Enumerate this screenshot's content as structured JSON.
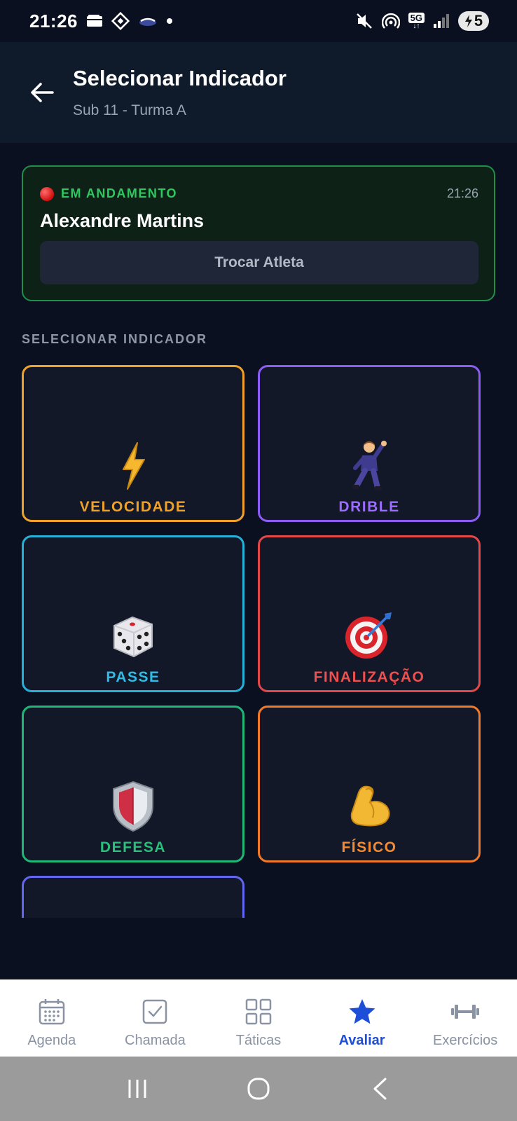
{
  "status_bar": {
    "time": "21:26",
    "network": "5G",
    "battery": "5"
  },
  "header": {
    "title": "Selecionar Indicador",
    "subtitle": "Sub 11 - Turma A"
  },
  "live_session": {
    "status": "EM ANDAMENTO",
    "time": "21:26",
    "athlete": "Alexandre Martins",
    "swap_button": "Trocar Atleta"
  },
  "section_label": "SELECIONAR INDICADOR",
  "indicators": [
    {
      "label": "VELOCIDADE",
      "icon": "⚡",
      "color": "#f0a12a"
    },
    {
      "label": "DRIBLE",
      "icon": "🕺",
      "color": "#9b6cff"
    },
    {
      "label": "PASSE",
      "icon": "🎲",
      "color": "#2fbce6"
    },
    {
      "label": "FINALIZAÇÃO",
      "icon": "🎯",
      "color": "#ee4f4f"
    },
    {
      "label": "DEFESA",
      "icon": "🛡️",
      "color": "#2ac07c"
    },
    {
      "label": "FÍSICO",
      "icon": "💪",
      "color": "#f58a32"
    }
  ],
  "bottom_nav": [
    {
      "label": "Agenda",
      "icon": "calendar-icon"
    },
    {
      "label": "Chamada",
      "icon": "checkbox-icon"
    },
    {
      "label": "Táticas",
      "icon": "grid-icon"
    },
    {
      "label": "Avaliar",
      "icon": "star-icon",
      "active": true
    },
    {
      "label": "Exercícios",
      "icon": "dumbbell-icon"
    }
  ],
  "colors": {
    "background": "#0b1020",
    "header": "#0f1a2a",
    "live_border": "#1f8f4a",
    "live_text": "#2fc860",
    "nav_active": "#1d4ed8"
  }
}
